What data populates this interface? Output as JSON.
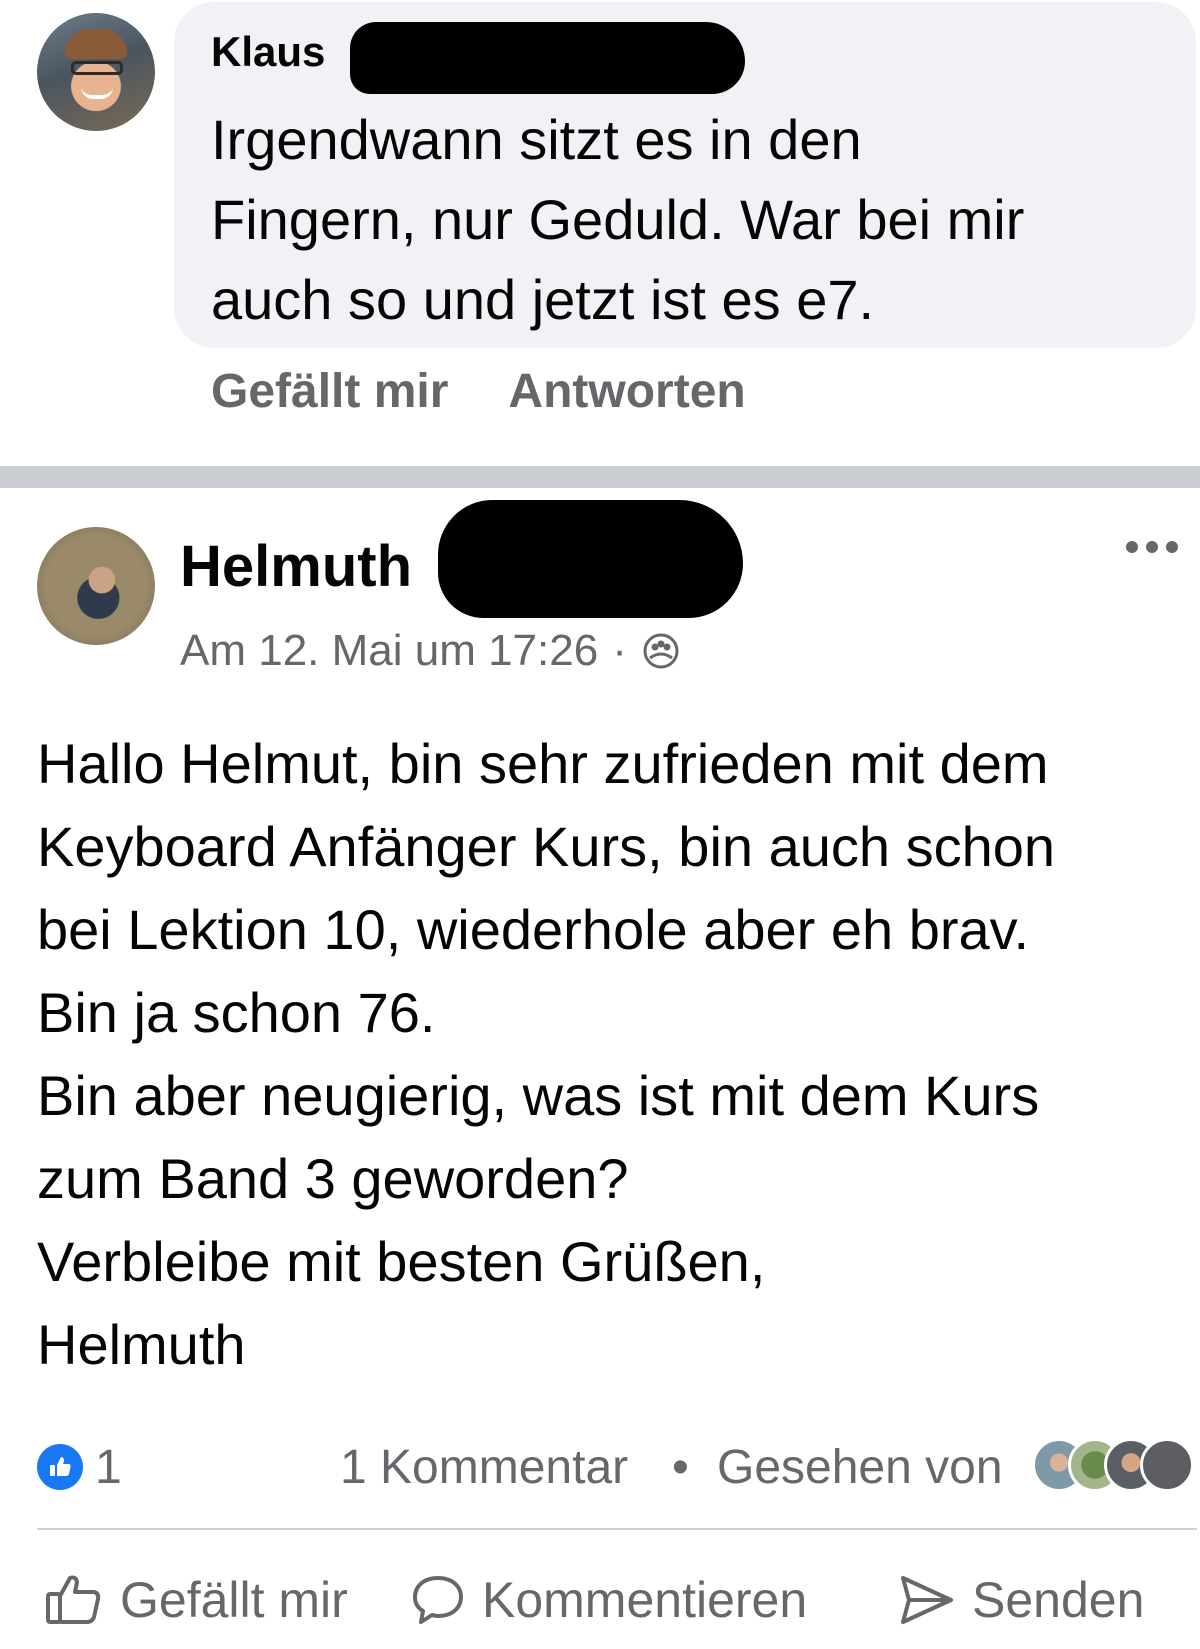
{
  "comment": {
    "author": "Klaus",
    "text_lines": [
      "Irgendwann sitzt es in den",
      "Fingern, nur Geduld. War bei mir",
      "auch so und jetzt ist es e7."
    ],
    "actions": {
      "like": "Gefällt mir",
      "reply": "Antworten"
    }
  },
  "post": {
    "author": "Helmuth",
    "timestamp": "Am 12. Mai um 17:26",
    "separator": "·",
    "privacy_icon": "group-icon",
    "body_lines": [
      "Hallo Helmut, bin sehr zufrieden mit dem",
      "Keyboard Anfänger Kurs, bin auch schon",
      "bei Lektion 10, wiederhole aber eh brav.",
      "Bin ja schon 76.",
      "Bin aber neugierig, was ist mit dem Kurs",
      "zum Band 3 geworden?",
      "Verbleibe mit besten Grüßen,",
      "Helmuth"
    ],
    "stats": {
      "like_count": "1",
      "comments": "1 Kommentar",
      "bullet": "•",
      "seen_by": "Gesehen von"
    },
    "actions": {
      "like": "Gefällt mir",
      "comment": "Kommentieren",
      "send": "Senden"
    }
  },
  "colors": {
    "bubble": "#f0f2f5",
    "secondary_text": "#65676b",
    "like_blue": "#1877f2",
    "divider": "#c9ccd1"
  }
}
